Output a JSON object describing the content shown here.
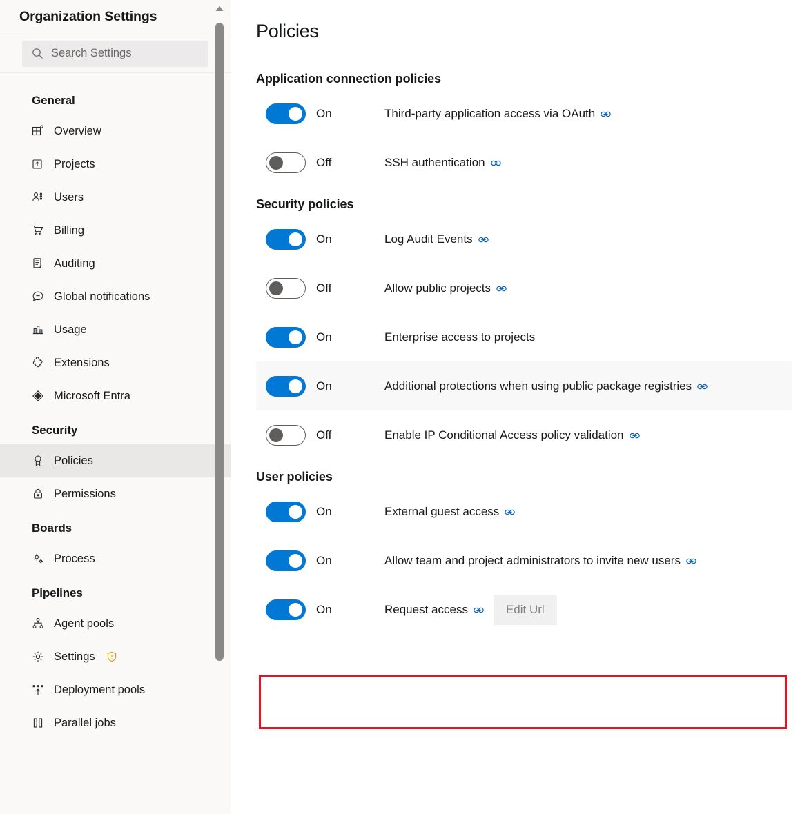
{
  "sidebar": {
    "title": "Organization Settings",
    "search": {
      "placeholder": "Search Settings",
      "icon": "search-icon"
    },
    "groups": [
      {
        "name": "General",
        "items": [
          {
            "label": "Overview",
            "icon": "overview-icon",
            "selected": false
          },
          {
            "label": "Projects",
            "icon": "projects-icon",
            "selected": false
          },
          {
            "label": "Users",
            "icon": "users-icon",
            "selected": false
          },
          {
            "label": "Billing",
            "icon": "billing-cart-icon",
            "selected": false
          },
          {
            "label": "Auditing",
            "icon": "auditing-icon",
            "selected": false
          },
          {
            "label": "Global notifications",
            "icon": "notification-icon",
            "selected": false
          },
          {
            "label": "Usage",
            "icon": "usage-chart-icon",
            "selected": false
          },
          {
            "label": "Extensions",
            "icon": "extensions-icon",
            "selected": false
          },
          {
            "label": "Microsoft Entra",
            "icon": "entra-icon",
            "selected": false
          }
        ]
      },
      {
        "name": "Security",
        "items": [
          {
            "label": "Policies",
            "icon": "policies-ribbon-icon",
            "selected": true
          },
          {
            "label": "Permissions",
            "icon": "lock-icon",
            "selected": false
          }
        ]
      },
      {
        "name": "Boards",
        "items": [
          {
            "label": "Process",
            "icon": "process-gears-icon",
            "selected": false
          }
        ]
      },
      {
        "name": "Pipelines",
        "items": [
          {
            "label": "Agent pools",
            "icon": "agent-pools-icon",
            "selected": false
          },
          {
            "label": "Settings",
            "icon": "gear-icon",
            "selected": false,
            "warning": "warning-shield-icon"
          },
          {
            "label": "Deployment pools",
            "icon": "deployment-pools-icon",
            "selected": false
          },
          {
            "label": "Parallel jobs",
            "icon": "parallel-jobs-icon",
            "selected": false
          }
        ]
      }
    ],
    "scrollbar": {
      "up_arrow": "scroll-up-arrow-icon"
    }
  },
  "main": {
    "page_title": "Policies",
    "sections": [
      {
        "title": "Application connection policies",
        "policies": [
          {
            "state": "On",
            "on": true,
            "label": "Third-party application access via OAuth",
            "link": true,
            "hovered": false
          },
          {
            "state": "Off",
            "on": false,
            "label": "SSH authentication",
            "link": true,
            "hovered": false
          }
        ]
      },
      {
        "title": "Security policies",
        "policies": [
          {
            "state": "On",
            "on": true,
            "label": "Log Audit Events",
            "link": true,
            "hovered": false
          },
          {
            "state": "Off",
            "on": false,
            "label": "Allow public projects",
            "link": true,
            "hovered": false
          },
          {
            "state": "On",
            "on": true,
            "label": "Enterprise access to projects",
            "link": false,
            "hovered": false
          },
          {
            "state": "On",
            "on": true,
            "label": "Additional protections when using public package registries",
            "link": true,
            "hovered": true
          },
          {
            "state": "Off",
            "on": false,
            "label": "Enable IP Conditional Access policy validation",
            "link": true,
            "hovered": false
          }
        ]
      },
      {
        "title": "User policies",
        "policies": [
          {
            "state": "On",
            "on": true,
            "label": "External guest access",
            "link": true,
            "hovered": false
          },
          {
            "state": "On",
            "on": true,
            "label": "Allow team and project administrators to invite new users",
            "link": true,
            "hovered": false,
            "highlighted": true
          },
          {
            "state": "On",
            "on": true,
            "label": "Request access",
            "link": true,
            "hovered": false,
            "button": "Edit Url"
          }
        ]
      }
    ]
  },
  "annotation": {
    "type": "red-highlight-box",
    "color": "#e81123",
    "target": "Allow team and project administrators to invite new users"
  },
  "colors": {
    "toggle_on": "#0078d4",
    "toggle_off_border": "#605e5c",
    "sidebar_bg": "#faf9f8",
    "selected_bg": "#e9e8e7",
    "link_icon": "#0a64b7",
    "warning": "#d9a000",
    "annotation_red": "#e81123"
  }
}
